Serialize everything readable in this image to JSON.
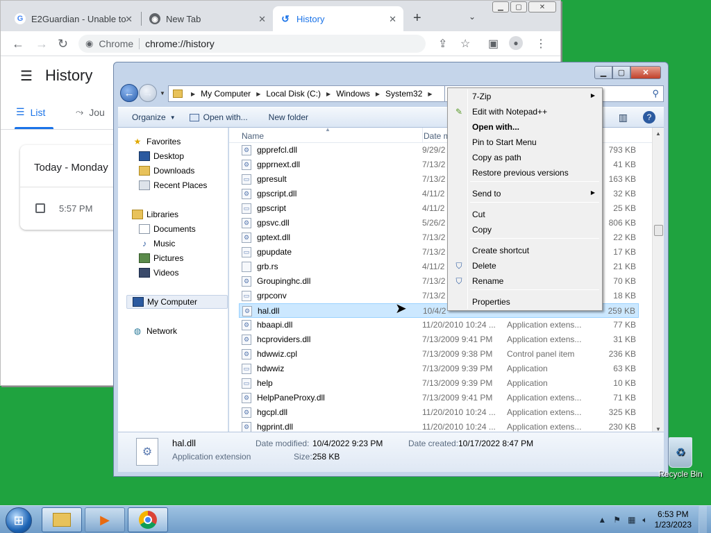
{
  "chrome": {
    "tabs": [
      {
        "label": "E2Guardian - Unable to",
        "favicon": "G"
      },
      {
        "label": "New Tab",
        "favicon": "chrome"
      },
      {
        "label": "History",
        "favicon": "history"
      }
    ],
    "new_tab": "+",
    "omnibox": {
      "site": "Chrome",
      "url": "chrome://history"
    },
    "page_title": "History",
    "history_tabs": [
      "List",
      "Jou"
    ],
    "card": {
      "day": "Today - Monday",
      "time": "5:57 PM"
    }
  },
  "explorer": {
    "breadcrumbs": [
      "My Computer",
      "Local Disk (C:)",
      "Windows",
      "System32"
    ],
    "commands": [
      "Organize",
      "Open with...",
      "New folder"
    ],
    "nav": {
      "favorites": {
        "label": "Favorites",
        "items": [
          "Desktop",
          "Downloads",
          "Recent Places"
        ]
      },
      "libraries": {
        "label": "Libraries",
        "items": [
          "Documents",
          "Music",
          "Pictures",
          "Videos"
        ]
      },
      "computer": "My Computer",
      "network": "Network"
    },
    "columns": {
      "name": "Name",
      "date": "Date m"
    },
    "files": [
      {
        "name": "gpprefcl.dll",
        "date": "9/29/2",
        "type": "",
        "size": "793 KB"
      },
      {
        "name": "gpprnext.dll",
        "date": "7/13/2",
        "type": "",
        "size": "41 KB"
      },
      {
        "name": "gpresult",
        "date": "7/13/2",
        "type": "",
        "size": "163 KB"
      },
      {
        "name": "gpscript.dll",
        "date": "4/11/2",
        "type": "",
        "size": "32 KB"
      },
      {
        "name": "gpscript",
        "date": "4/11/2",
        "type": "",
        "size": "25 KB"
      },
      {
        "name": "gpsvc.dll",
        "date": "5/26/2",
        "type": "",
        "size": "806 KB"
      },
      {
        "name": "gptext.dll",
        "date": "7/13/2",
        "type": "",
        "size": "22 KB"
      },
      {
        "name": "gpupdate",
        "date": "7/13/2",
        "type": "",
        "size": "17 KB"
      },
      {
        "name": "grb.rs",
        "date": "4/11/2",
        "type": "",
        "size": "21 KB"
      },
      {
        "name": "Groupinghc.dll",
        "date": "7/13/2",
        "type": "",
        "size": "70 KB"
      },
      {
        "name": "grpconv",
        "date": "7/13/2",
        "type": "",
        "size": "18 KB"
      },
      {
        "name": "hal.dll",
        "date": "10/4/2",
        "type": "",
        "size": "259 KB"
      },
      {
        "name": "hbaapi.dll",
        "date": "11/20/2010 10:24 ...",
        "type": "Application extens...",
        "size": "77 KB"
      },
      {
        "name": "hcproviders.dll",
        "date": "7/13/2009 9:41 PM",
        "type": "Application extens...",
        "size": "31 KB"
      },
      {
        "name": "hdwwiz.cpl",
        "date": "7/13/2009 9:38 PM",
        "type": "Control panel item",
        "size": "236 KB"
      },
      {
        "name": "hdwwiz",
        "date": "7/13/2009 9:39 PM",
        "type": "Application",
        "size": "63 KB"
      },
      {
        "name": "help",
        "date": "7/13/2009 9:39 PM",
        "type": "Application",
        "size": "10 KB"
      },
      {
        "name": "HelpPaneProxy.dll",
        "date": "7/13/2009 9:41 PM",
        "type": "Application extens...",
        "size": "71 KB"
      },
      {
        "name": "hgcpl.dll",
        "date": "11/20/2010 10:24 ...",
        "type": "Application extens...",
        "size": "325 KB"
      },
      {
        "name": "hgprint.dll",
        "date": "11/20/2010 10:24 ...",
        "type": "Application extens...",
        "size": "230 KB"
      }
    ],
    "selected_index": 11,
    "details": {
      "name": "hal.dll",
      "kind": "Application extension",
      "modified_label": "Date modified:",
      "modified": "10/4/2022 9:23 PM",
      "created_label": "Date created:",
      "created": "10/17/2022 8:47 PM",
      "size_label": "Size:",
      "size": "258 KB"
    }
  },
  "context_menu": [
    {
      "label": "7-Zip",
      "submenu": true
    },
    {
      "label": "Edit with Notepad++"
    },
    {
      "label": "Open with...",
      "bold": true
    },
    {
      "label": "Pin to Start Menu"
    },
    {
      "label": "Copy as path"
    },
    {
      "label": "Restore previous versions"
    },
    {
      "label": "Send to",
      "submenu": true
    },
    {
      "label": "Cut"
    },
    {
      "label": "Copy"
    },
    {
      "label": "Create shortcut"
    },
    {
      "label": "Delete",
      "shield": true
    },
    {
      "label": "Rename",
      "shield": true
    },
    {
      "label": "Properties"
    }
  ],
  "desktop": {
    "recycle_bin": "Recycle Bin"
  },
  "taskbar": {
    "time": "6:53 PM",
    "date": "1/23/2023"
  }
}
